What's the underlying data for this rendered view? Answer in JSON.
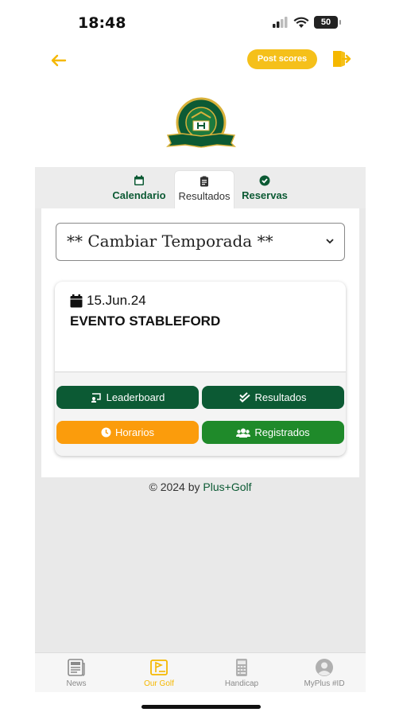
{
  "status": {
    "time": "18:48",
    "battery": "50"
  },
  "topbar": {
    "post_scores": "Post scores"
  },
  "tabs": [
    {
      "label": "Calendario"
    },
    {
      "label": "Resultados"
    },
    {
      "label": "Reservas"
    }
  ],
  "season_select": {
    "value": "** Cambiar Temporada **"
  },
  "event": {
    "date": "15.Jun.24",
    "title": "EVENTO STABLEFORD",
    "buttons": {
      "leaderboard": "Leaderboard",
      "resultados": "Resultados",
      "horarios": "Horarios",
      "registrados": "Registrados"
    }
  },
  "footer": {
    "prefix": "© 2024 by ",
    "brand": "Plus+Golf"
  },
  "bottom_nav": [
    {
      "label": "News"
    },
    {
      "label": "Our Golf"
    },
    {
      "label": "Handicap"
    },
    {
      "label": "MyPlus #ID"
    }
  ],
  "colors": {
    "primary_green": "#0c5a34",
    "accent_yellow": "#f5c01a",
    "orange": "#fb9c0c",
    "light_green": "#1f8a2a"
  }
}
